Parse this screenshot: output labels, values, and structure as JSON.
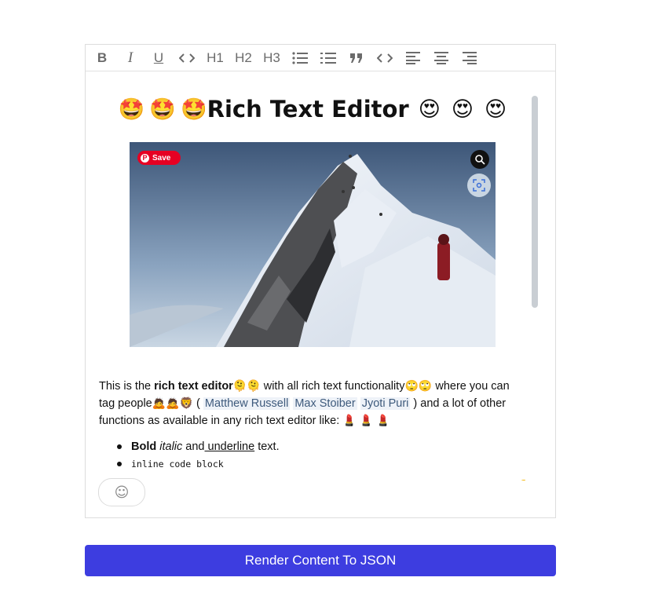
{
  "toolbar": {
    "bold": "B",
    "italic": "I",
    "underline": "U",
    "h1": "H1",
    "h2": "H2",
    "h3": "H3"
  },
  "editor": {
    "heading_text": "Rich Text Editor",
    "heading_emoji": "🤩",
    "heading_emoji_right": "😍",
    "image": {
      "pin_label": "Save"
    },
    "paragraph": {
      "t1": "This is the ",
      "bold": "rich text editor",
      "t2": " with all rich text functionality",
      "t3": " where you can tag people",
      "t4": " ( ",
      "tags": [
        "Matthew Russell",
        "Max Stoiber",
        "Jyoti Puri"
      ],
      "t5": " ) and a lot of other functions as available in any rich text editor like: "
    },
    "list": {
      "bold": "Bold",
      "italic": "italic",
      "and": " and",
      "underline": " underline",
      "text": " text.",
      "code": "inline code block"
    },
    "emoji_button": "☺",
    "grammarly_badge": "1"
  },
  "render_button": "Render Content To JSON"
}
